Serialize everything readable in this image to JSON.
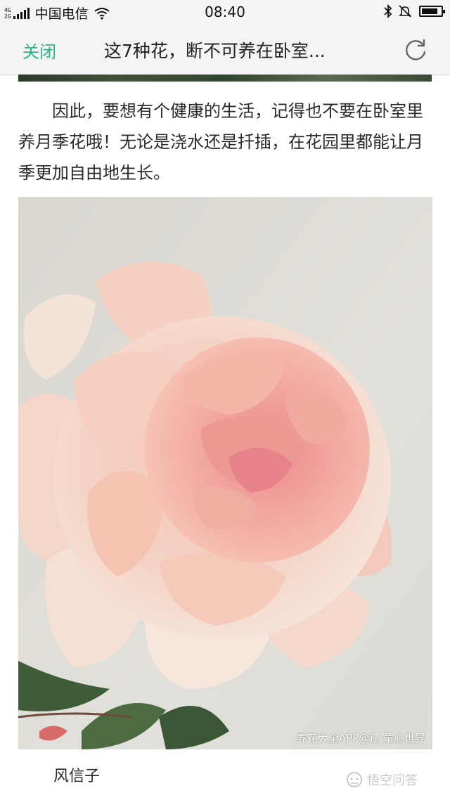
{
  "status_bar": {
    "net_top": "4G",
    "net_bottom": "2G",
    "carrier": "中国电信",
    "time": "08:40"
  },
  "nav": {
    "close_label": "关闭",
    "title": "这7种花，断不可养在卧室..."
  },
  "article": {
    "paragraph": "因此，要想有个健康的生活，记得也不要在卧室里养月季花哦！无论是浇水还是扦插，在花园里都能让月季更加自由地生长。",
    "image_watermark": "养花大全APP@辽  童心世界",
    "caption": "风信子"
  },
  "logo": {
    "text": "悟空问答"
  },
  "colors": {
    "accent": "#2bb58c",
    "bar_bg": "#f4f4f4",
    "rose_pink": "#f2a7a3"
  },
  "icons": [
    "wifi-icon",
    "bluetooth-icon",
    "bell-mute-icon",
    "battery-icon",
    "refresh-icon"
  ]
}
